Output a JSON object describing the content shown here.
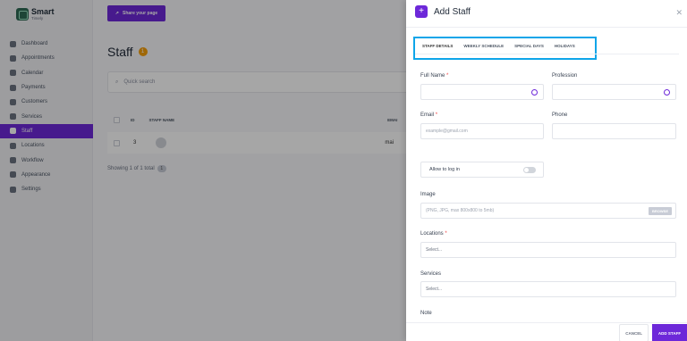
{
  "app": {
    "logo_title": "Smart",
    "logo_subtitle": "Timely"
  },
  "sidebar": {
    "items": [
      {
        "label": "Dashboard",
        "icon": "dashboard-icon"
      },
      {
        "label": "Appointments",
        "icon": "clock-icon"
      },
      {
        "label": "Calendar",
        "icon": "calendar-icon"
      },
      {
        "label": "Payments",
        "icon": "wallet-icon"
      },
      {
        "label": "Customers",
        "icon": "users-icon"
      },
      {
        "label": "Services",
        "icon": "list-icon"
      },
      {
        "label": "Staff",
        "icon": "user-icon",
        "active": true
      },
      {
        "label": "Locations",
        "icon": "location-icon"
      },
      {
        "label": "Workflow",
        "icon": "workflow-icon"
      },
      {
        "label": "Appearance",
        "icon": "brush-icon"
      },
      {
        "label": "Settings",
        "icon": "gear-icon"
      }
    ]
  },
  "main": {
    "share_label": "Share your page",
    "title": "Staff",
    "count": "1",
    "search_placeholder": "Quick search",
    "columns": {
      "id": "ID",
      "staff_name": "STAFF NAME",
      "email": "EMAI"
    },
    "row": {
      "id": "3",
      "email": "mai"
    },
    "showing": "Showing 1 of 1 total",
    "showing_count": "1"
  },
  "modal": {
    "title": "Add Staff",
    "tabs": [
      "STAFF DETAILS",
      "WEEKLY SCHEDULE",
      "SPECIAL DAYS",
      "HOLIDAYS"
    ],
    "full_name_label": "Full Name",
    "profession_label": "Profession",
    "email_label": "Email",
    "email_placeholder": "example@gmail.com",
    "phone_label": "Phone",
    "allow_login_label": "Allow to log in",
    "image_label": "Image",
    "image_placeholder": "(PNG, JPG, max 800x800 to 5mb)",
    "browse_label": "BROWSE",
    "locations_label": "Locations",
    "locations_placeholder": "Select...",
    "services_label": "Services",
    "services_placeholder": "Select...",
    "note_label": "Note",
    "cancel_label": "CANCEL",
    "add_label": "ADD STAFF",
    "required_mark": "*"
  },
  "colors": {
    "accent": "#6d28d9",
    "highlight": "#0ea5e9",
    "badge": "#f59e0b"
  }
}
